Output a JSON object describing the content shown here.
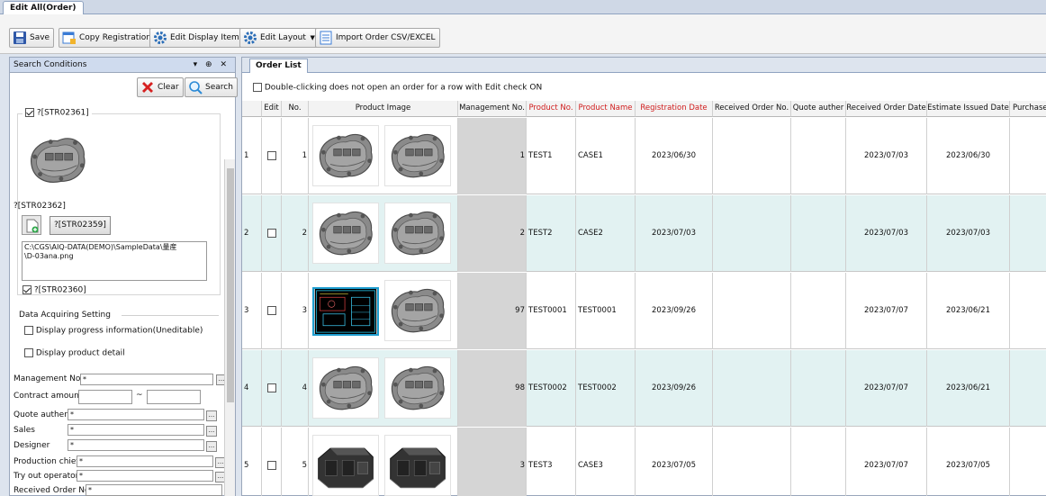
{
  "window": {
    "doc_tab": "Edit All(Order)"
  },
  "toolbar": {
    "save": "Save",
    "copy_registration": "Copy Registration",
    "edit_display_item": "Edit Display Item",
    "edit_layout": "Edit Layout",
    "import_csv": "Import Order CSV/EXCEL"
  },
  "search_panel": {
    "title": "Search Conditions",
    "controls": "▾ ⊕ ✕",
    "clear": "Clear",
    "search": "Search",
    "group1_label": "?[STR02361]",
    "str02362": "?[STR02362]",
    "str02359": "?[STR02359]",
    "path_line1": "C:\\CGS\\AIQ-DATA(DEMO)\\SampleData\\量産",
    "path_line2": "\\D-03ana.png",
    "str02360": "?[STR02360]",
    "data_acquiring": "Data Acquiring Setting",
    "display_progress": "Display progress information(Uneditable)",
    "display_product": "Display product detail",
    "fields": [
      {
        "label": "Management No.",
        "value": "*"
      },
      {
        "label": "Contract amount",
        "value": ""
      },
      {
        "label": "Quote auther",
        "value": "*"
      },
      {
        "label": "Sales",
        "value": "*"
      },
      {
        "label": "Designer",
        "value": "*"
      },
      {
        "label": "Production chief",
        "value": "*"
      },
      {
        "label": "Try out operator",
        "value": "*"
      },
      {
        "label": "Received Order No.",
        "value": "*"
      }
    ],
    "tilde": "~"
  },
  "order_list": {
    "tab": "Order List",
    "notice": "Double-clicking does not open an order for a row with Edit check ON",
    "headers": [
      "",
      "Edit",
      "No.",
      "Product Image",
      "Management No.",
      "Product No.",
      "Product Name",
      "Registration Date",
      "Received Order No.",
      "Quote auther",
      "Received Order Date",
      "Estimate Issued Date",
      "Purchase O"
    ],
    "rows": [
      {
        "idx": "1",
        "no": "1",
        "mgmt": "1",
        "prod_no": "TEST1",
        "prod_name": "CASE1",
        "reg_date": "2023/06/30",
        "recv_date": "2023/07/03",
        "est_date": "2023/06/30"
      },
      {
        "idx": "2",
        "no": "2",
        "mgmt": "2",
        "prod_no": "TEST2",
        "prod_name": "CASE2",
        "reg_date": "2023/07/03",
        "recv_date": "2023/07/03",
        "est_date": "2023/07/03"
      },
      {
        "idx": "3",
        "no": "3",
        "mgmt": "97",
        "prod_no": "TEST0001",
        "prod_name": "TEST0001",
        "reg_date": "2023/09/26",
        "recv_date": "2023/07/07",
        "est_date": "2023/06/21"
      },
      {
        "idx": "4",
        "no": "4",
        "mgmt": "98",
        "prod_no": "TEST0002",
        "prod_name": "TEST0002",
        "reg_date": "2023/09/26",
        "recv_date": "2023/07/07",
        "est_date": "2023/06/21"
      },
      {
        "idx": "5",
        "no": "5",
        "mgmt": "3",
        "prod_no": "TEST3",
        "prod_name": "CASE3",
        "reg_date": "2023/07/05",
        "recv_date": "2023/07/07",
        "est_date": "2023/07/05"
      }
    ]
  }
}
